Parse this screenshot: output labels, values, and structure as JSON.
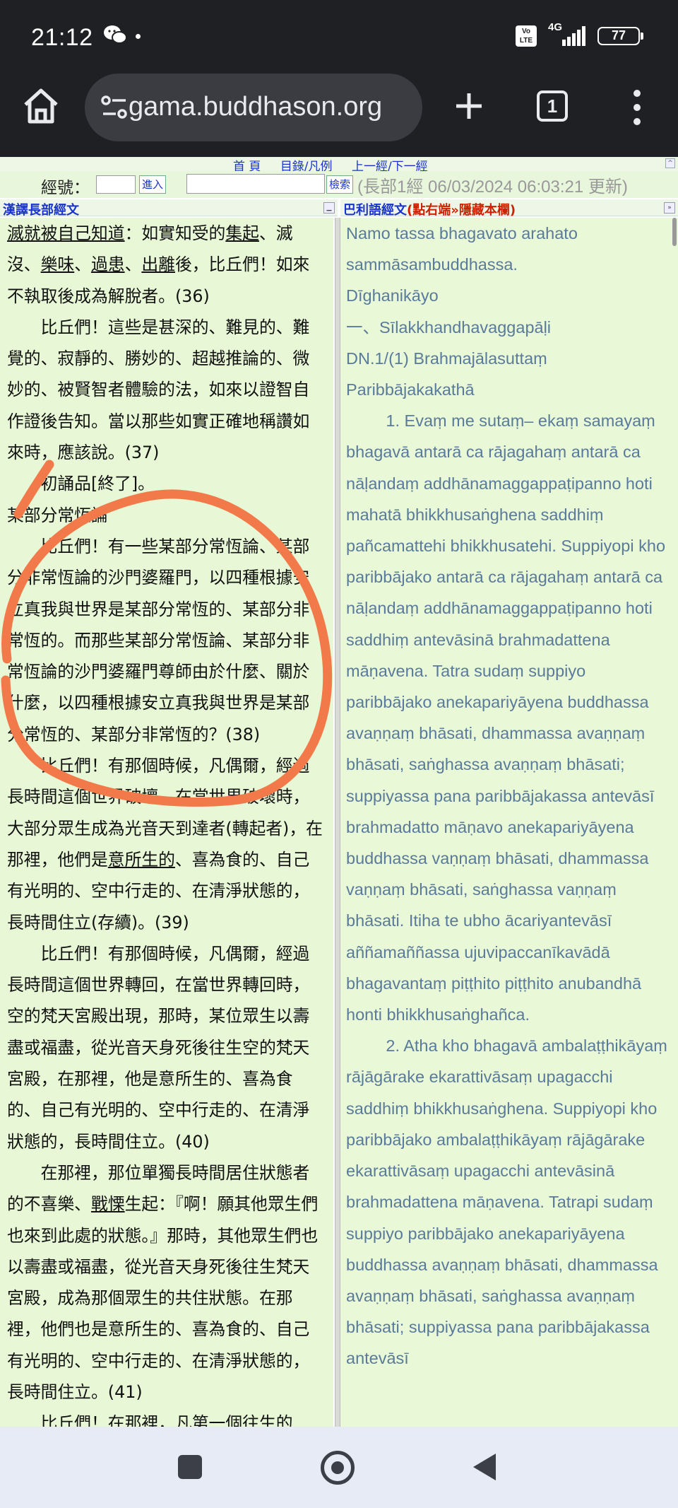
{
  "status_bar": {
    "time": "21:12",
    "network": "4G",
    "volte": "Vo\nLTE",
    "battery": "77"
  },
  "browser": {
    "url": "gama.buddhason.org",
    "tab_count": "1"
  },
  "site": {
    "nav": [
      "首 頁",
      "目錄/凡例",
      "上一經/下一經"
    ],
    "sutra_no_label": "經號：",
    "go_button": "進入",
    "search_button": "檢索",
    "update_text": "(長部1經 06/03/2024 06:03:21 更新)",
    "left_pane_title": "漢譯長部經文",
    "right_pane_title": "巴利語經文",
    "right_pane_hint": "(點右端»隱藏本欄)"
  },
  "chinese_paragraphs": [
    {
      "indent": false,
      "segments": [
        {
          "t": "滅就被自己知道",
          "u": true
        },
        {
          "t": "：如實知受的"
        },
        {
          "t": "集起",
          "u": true
        },
        {
          "t": "、滅沒、"
        },
        {
          "t": "樂味",
          "u": true
        },
        {
          "t": "、"
        },
        {
          "t": "過患",
          "u": true
        },
        {
          "t": "、"
        },
        {
          "t": "出離",
          "u": true
        },
        {
          "t": "後，比丘們！如來不執取後成為解脫者。(36)"
        }
      ]
    },
    {
      "indent": true,
      "segments": [
        {
          "t": "比丘們！這些是甚深的、難見的、難覺的、寂靜的、勝妙的、超越推論的、微妙的、被賢智者體驗的法，如來以證智自作證後告知。當以那些如實正確地稱讚如來時，應該說。(37)"
        }
      ]
    },
    {
      "indent": true,
      "segments": [
        {
          "t": "初誦品[終了]。"
        }
      ]
    },
    {
      "indent": false,
      "segments": [
        {
          "t": "某部分常恆論"
        }
      ]
    },
    {
      "indent": true,
      "segments": [
        {
          "t": "比丘們！有一些某部分常恆論、某部分非常恆論的沙門婆羅門，以四種根據安立真我與世界是某部分常恆的、某部分非常恆的。而那些某部分常恆論、某部分非常恆論的沙門婆羅門尊師由於什麼、關於什麼，以四種根據安立真我與世界是某部分常恆的、某部分非常恆的？(38)"
        }
      ]
    },
    {
      "indent": true,
      "segments": [
        {
          "t": "比丘們！有那個時候，凡偶爾，經過長時間這個世界破壞。在當世界破壞時，大部分眾生成為光音天到達者(轉起者)，在那裡，他們是"
        },
        {
          "t": "意所生的",
          "u": true
        },
        {
          "t": "、喜為食的、自己有光明的、空中行走的、在清淨狀態的，長時間住立(存續)。(39)"
        }
      ]
    },
    {
      "indent": true,
      "segments": [
        {
          "t": "比丘們！有那個時候，凡偶爾，經過長時間這個世界轉回，在當世界轉回時，空的梵天宮殿出現，那時，某位眾生以壽盡或福盡，從光音天身死後往生空的梵天宮殿，在那裡，他是意所生的、喜為食的、自己有光明的、空中行走的、在清淨狀態的，長時間住立。(40)"
        }
      ]
    },
    {
      "indent": true,
      "segments": [
        {
          "t": "在那裡，那位單獨長時間居住狀態者的不喜樂、"
        },
        {
          "t": "戰慄",
          "u": true
        },
        {
          "t": "生起：『啊！願其他眾生們也來到此處的狀態。』那時，其他眾生們也以壽盡或福盡，從光音天身死後往生梵天宮殿，成為那個眾生的共住狀態。在那裡，他們也是意所生的、喜為食的、自己有光明的、空中行走的、在清淨狀態的，長時間住立。(41)"
        }
      ]
    },
    {
      "indent": true,
      "segments": [
        {
          "t": "比丘們！在那裡，凡第一個往生的"
        }
      ]
    }
  ],
  "pali_paragraphs": [
    {
      "indent": false,
      "text": "Namo tassa bhagavato arahato sammāsambuddhassa."
    },
    {
      "indent": false,
      "text": "Dīghanikāyo"
    },
    {
      "indent": false,
      "text": "一、Sīlakkhandhavaggapāḷi"
    },
    {
      "indent": false,
      "text": "DN.1/(1) Brahmajālasuttaṃ"
    },
    {
      "indent": false,
      "text": "Paribbājakakathā"
    },
    {
      "indent": true,
      "text": "1. Evaṃ me sutaṃ– ekaṃ samayaṃ bhagavā antarā ca rājagahaṃ antarā ca nāḷandaṃ addhānamaggappaṭipanno hoti mahatā bhikkhusaṅghena saddhiṃ pañcamattehi bhikkhusatehi. Suppiyopi kho paribbājako antarā ca rājagahaṃ antarā ca nāḷandaṃ addhānamaggappaṭipanno hoti saddhiṃ antevāsinā brahmadattena māṇavena. Tatra sudaṃ suppiyo paribbājako anekapariyāyena buddhassa avaṇṇaṃ bhāsati, dhammassa avaṇṇaṃ bhāsati, saṅghassa avaṇṇaṃ bhāsati; suppiyassa pana paribbājakassa antevāsī brahmadatto māṇavo anekapariyāyena buddhassa vaṇṇaṃ bhāsati, dhammassa vaṇṇaṃ bhāsati, saṅghassa vaṇṇaṃ bhāsati. Itiha te ubho ācariyantevāsī aññamaññassa ujuvipaccanīkavādā bhagavantaṃ piṭṭhito piṭṭhito anubandhā honti bhikkhusaṅghañca."
    },
    {
      "indent": true,
      "text": "2. Atha kho bhagavā ambalaṭṭhikāyaṃ rājāgārake ekarattivāsaṃ upagacchi saddhiṃ bhikkhusaṅghena. Suppiyopi kho paribbājako ambalaṭṭhikāyaṃ rājāgārake ekarattivāsaṃ upagacchi antevāsinā brahmadattena māṇavena. Tatrapi sudaṃ suppiyo paribbājako anekapariyāyena buddhassa avaṇṇaṃ bhāsati, dhammassa avaṇṇaṃ bhāsati, saṅghassa avaṇṇaṃ bhāsati; suppiyassa pana paribbājakassa antevāsī"
    }
  ],
  "colors": {
    "status_bg": "#1f2023",
    "left_pane_bg": "#e8f8d6",
    "right_pane_bg": "#e9f9d8",
    "pali_text": "#5a7a9a",
    "link_blue": "#1a33cc",
    "annotation_orange": "#f27a4a",
    "nav_bar_bg": "#e7ebf5"
  }
}
